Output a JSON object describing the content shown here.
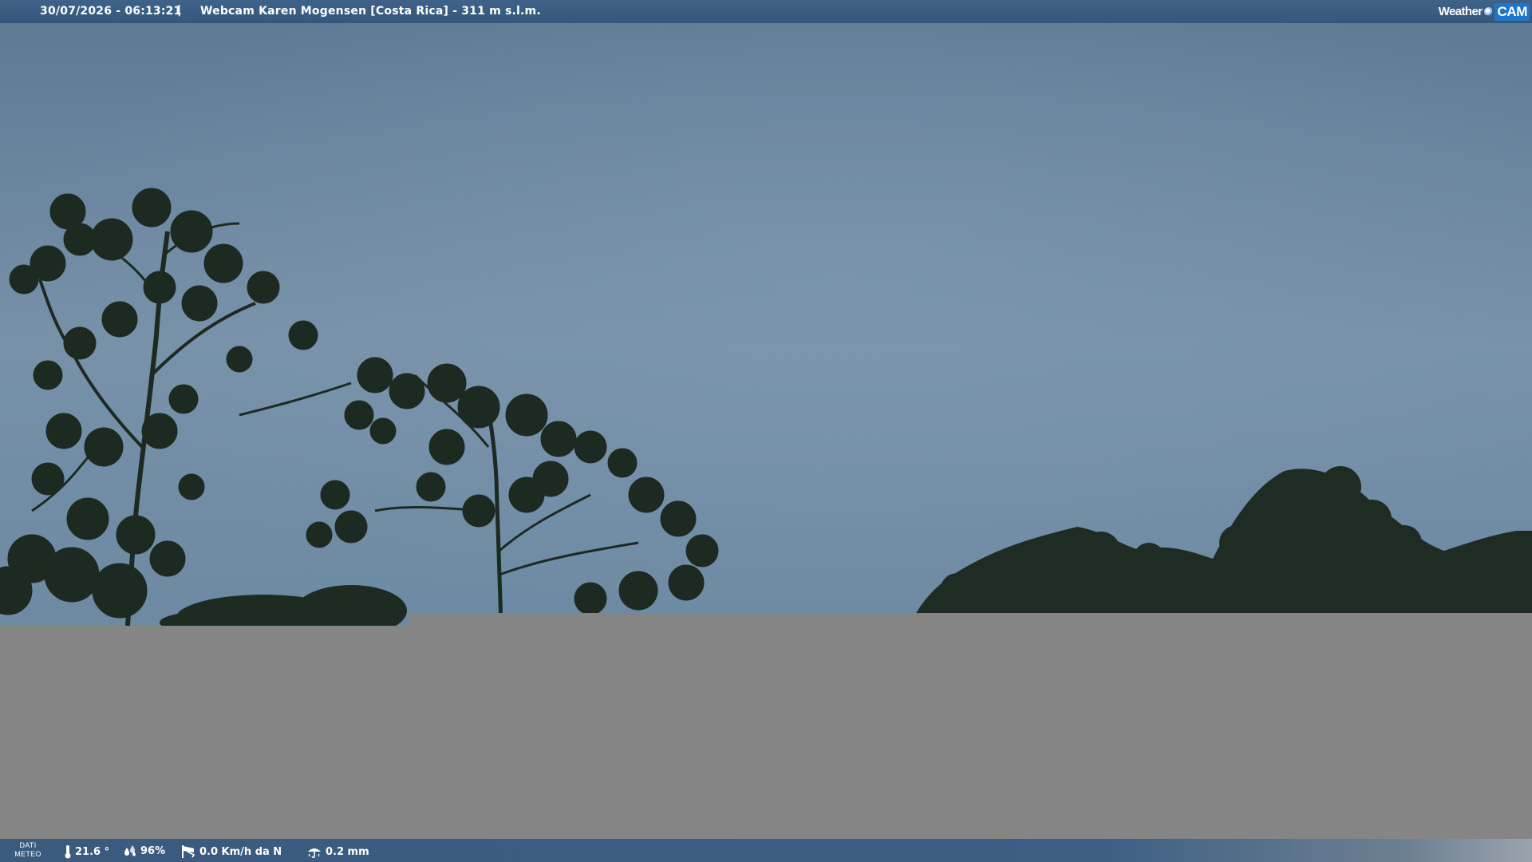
{
  "header": {
    "datetime": "30/07/2026 - 06:13:21",
    "separator": "|",
    "caption": "Webcam Karen Mogensen [Costa Rica] - 311 m s.l.m."
  },
  "brand": {
    "name_part1": "Weather",
    "name_part2": "CAM",
    "icon": "camera-lens-icon"
  },
  "meteo": {
    "label_line1": "DATI",
    "label_line2": "METEO",
    "temperature": "21.6 °",
    "humidity": "96%",
    "wind": "0.0 Km/h da N",
    "rain": "0.2 mm"
  },
  "icons": {
    "temperature": "thermometer-icon",
    "humidity": "droplets-icon",
    "wind": "windsock-icon",
    "rain": "rain-gauge-icon"
  },
  "colors": {
    "bar_blue": "#3a5a7e",
    "logo_blue": "#1f75c9",
    "sky_top": "#5d7893",
    "sky_mid": "#7691a8",
    "sky_bottom": "#6d8aa3",
    "foliage": "#1d2a22",
    "lower_panel": "#858585"
  }
}
